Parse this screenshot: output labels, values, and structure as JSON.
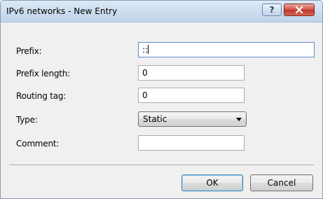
{
  "window": {
    "title": "IPv6 networks - New Entry",
    "help_label": "?",
    "close_icon": "close-icon"
  },
  "form": {
    "prefix": {
      "label": "Prefix:",
      "value": "::"
    },
    "prefix_length": {
      "label": "Prefix length:",
      "value": "0"
    },
    "routing_tag": {
      "label": "Routing tag:",
      "value": "0"
    },
    "type": {
      "label": "Type:",
      "selected": "Static"
    },
    "comment": {
      "label": "Comment:",
      "value": ""
    }
  },
  "buttons": {
    "ok_label": "OK",
    "cancel_label": "Cancel"
  },
  "colors": {
    "title_bar": "#cfdff1",
    "close_button": "#c0392b",
    "focus_border": "#5b8bc6"
  }
}
